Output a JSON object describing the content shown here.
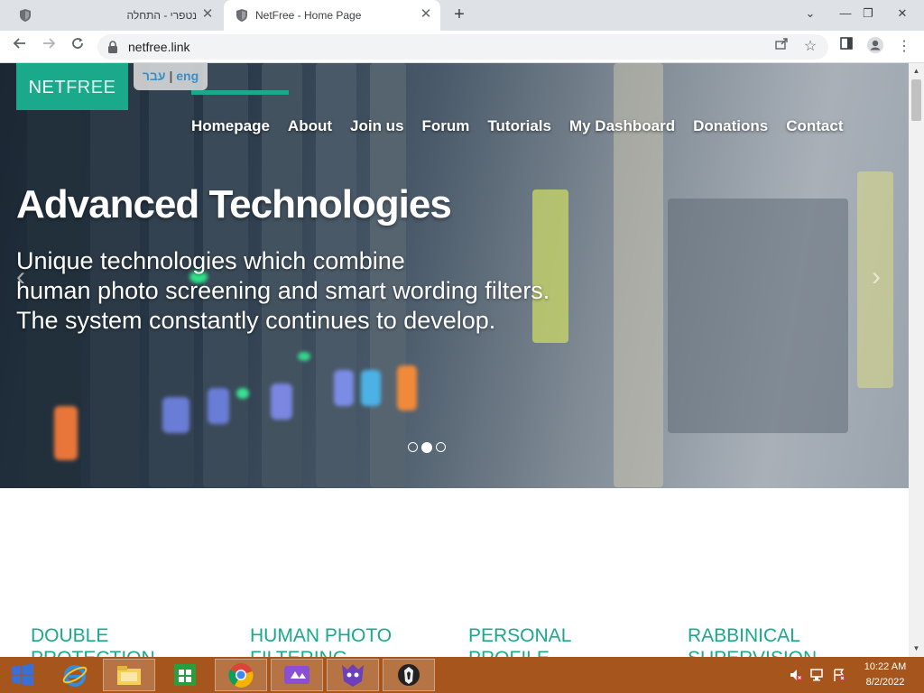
{
  "browser": {
    "tabs": [
      {
        "title": "נטפרי - התחלה",
        "active": false
      },
      {
        "title": "NetFree - Home Page",
        "active": true
      }
    ],
    "url": "netfree.link"
  },
  "site": {
    "logo_main": "NET",
    "logo_thin": "FREE",
    "lang_hebrew": "עבר",
    "lang_separator": "|",
    "lang_english": "eng",
    "nav": [
      "Homepage",
      "About",
      "Join us",
      "Forum",
      "Tutorials",
      "My Dashboard",
      "Donations",
      "Contact"
    ],
    "hero": {
      "title": "Advanced Technologies",
      "subtitle_lines": [
        "Unique technologies which combine",
        "human photo screening and smart wording filters.",
        "The system constantly continues to develop."
      ],
      "active_slide": 2,
      "slide_count": 3
    },
    "features": [
      {
        "line1": "DOUBLE",
        "line2": "PROTECTION"
      },
      {
        "line1": "HUMAN PHOTO",
        "line2": "FILTERING"
      },
      {
        "line1": "PERSONAL PROFILE",
        "line2": ""
      },
      {
        "line1": "RABBINICAL",
        "line2": "SUPERVISION"
      }
    ]
  },
  "taskbar": {
    "time": "10:22 AM",
    "date": "8/2/2022"
  },
  "colors": {
    "brand": "#1aa98b",
    "taskbar": "#a6561c",
    "tab_strip": "#dee1e6"
  }
}
